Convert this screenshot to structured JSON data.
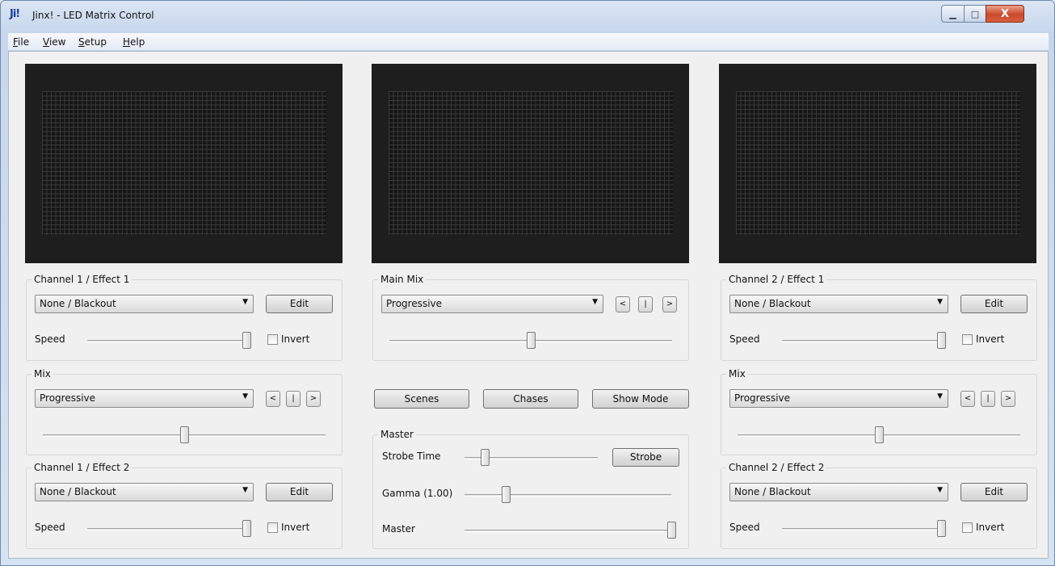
{
  "window": {
    "logo": "Ji!",
    "title": "Jinx! - LED Matrix Control",
    "close_glyph": "X"
  },
  "menu": [
    {
      "mnemonic": "F",
      "rest": "ile"
    },
    {
      "mnemonic": "V",
      "rest": "iew"
    },
    {
      "mnemonic": "S",
      "rest": "etup"
    },
    {
      "mnemonic": "H",
      "rest": "elp"
    }
  ],
  "left": {
    "effect1": {
      "title": "Channel 1 / Effect 1",
      "effect": "None / Blackout",
      "edit": "Edit",
      "speed_label": "Speed",
      "speed": 1.0,
      "invert_label": "Invert",
      "invert": false
    },
    "mix": {
      "title": "Mix",
      "mode": "Progressive",
      "prev": "<",
      "pause": "|",
      "next": ">",
      "level": 0.5
    },
    "effect2": {
      "title": "Channel 1 / Effect 2",
      "effect": "None / Blackout",
      "edit": "Edit",
      "speed_label": "Speed",
      "speed": 1.0,
      "invert_label": "Invert",
      "invert": false
    }
  },
  "center": {
    "mainmix": {
      "title": "Main Mix",
      "mode": "Progressive",
      "prev": "<",
      "pause": "|",
      "next": ">",
      "level": 0.5
    },
    "scenes": "Scenes",
    "chases": "Chases",
    "showmode": "Show Mode",
    "master": {
      "title": "Master",
      "strobe_label": "Strobe Time",
      "strobe_value": 0.15,
      "strobe_btn": "Strobe",
      "gamma_label": "Gamma (1.00)",
      "gamma_value": 0.2,
      "master_label": "Master",
      "master_value": 1.0
    }
  },
  "right": {
    "effect1": {
      "title": "Channel 2 / Effect 1",
      "effect": "None / Blackout",
      "edit": "Edit",
      "speed_label": "Speed",
      "speed": 1.0,
      "invert_label": "Invert",
      "invert": false
    },
    "mix": {
      "title": "Mix",
      "mode": "Progressive",
      "prev": "<",
      "pause": "|",
      "next": ">",
      "level": 0.5
    },
    "effect2": {
      "title": "Channel 2 / Effect 2",
      "effect": "None / Blackout",
      "edit": "Edit",
      "speed_label": "Speed",
      "speed": 1.0,
      "invert_label": "Invert",
      "invert": false
    }
  }
}
